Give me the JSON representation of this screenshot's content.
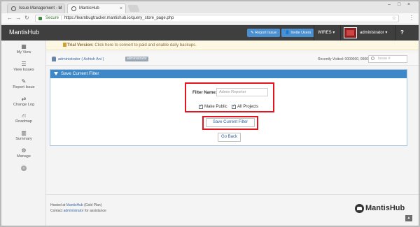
{
  "browser": {
    "tabs": [
      {
        "label": "Issue Management - M"
      },
      {
        "label": "MantisHub"
      }
    ],
    "address": {
      "secure_label": "Secure",
      "url": "https://learnbugtracker.mantishub.io/query_store_page.php"
    }
  },
  "navbar": {
    "brand": "MantisHub",
    "report_issue": "Report Issue",
    "invite_users": "Invite Users",
    "project": "WIRES",
    "user": "administrator",
    "help": "?"
  },
  "sidebar": {
    "items": [
      {
        "label": "My View",
        "icon": "dashboard-icon"
      },
      {
        "label": "View Issues",
        "icon": "list-icon"
      },
      {
        "label": "Report Issue",
        "icon": "pencil-icon"
      },
      {
        "label": "Change Log",
        "icon": "retweet-icon"
      },
      {
        "label": "Roadmap",
        "icon": "road-icon"
      },
      {
        "label": "Summary",
        "icon": "bar-chart-icon"
      },
      {
        "label": "Manage",
        "icon": "gears-icon"
      }
    ]
  },
  "trial": {
    "title": "Trial Version:",
    "text": "Click here to convert to paid and enable daily backups."
  },
  "breadcrumb": {
    "user": "administrator ( Ashish Ani )",
    "role": "administrator",
    "recently_visited": "Recently Visited: 0000000, 0000000",
    "issue_placeholder": "Issue #"
  },
  "panel": {
    "title": "Save Current Filter",
    "filter_name_label": "Filter Name:",
    "filter_name_value": "Admin Reporter",
    "make_public": "Make Public",
    "all_projects": "All Projects",
    "save_button": "Save Current Filter",
    "back_button": "Go Back"
  },
  "footer": {
    "hosted_prefix": "Hosted at",
    "hosted_link": "MantisHub",
    "hosted_suffix": "(Gold Plan)",
    "contact_prefix": "Contact",
    "contact_link": "administrator",
    "contact_suffix": "for assistance",
    "logo_text": "MantisHub"
  },
  "colors": {
    "accent_blue": "#3f88c7",
    "highlight_red": "#e3151f",
    "navbar": "#3f3f3f"
  }
}
